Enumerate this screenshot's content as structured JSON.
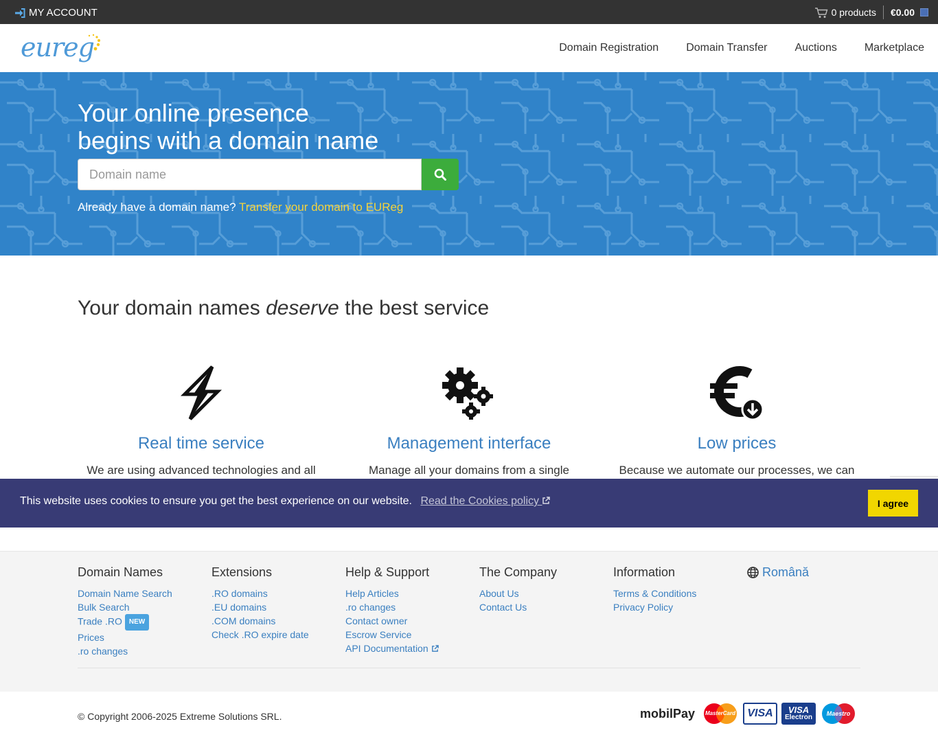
{
  "topbar": {
    "account_label": "MY ACCOUNT",
    "cart_products": "0 products",
    "cart_total": "€0.00"
  },
  "header": {
    "logo_text": "eureg",
    "nav": [
      "Domain Registration",
      "Domain Transfer",
      "Auctions",
      "Marketplace"
    ]
  },
  "hero": {
    "title_line1": "Your online presence",
    "title_line2": "begins with a domain name",
    "search_placeholder": "Domain name",
    "transfer_prefix": "Already have a domain name?",
    "transfer_link": "Transfer your domain to EUReg"
  },
  "service": {
    "title_before": "Your domain names ",
    "title_emphasis": "deserve",
    "title_after": " the best service",
    "features": [
      {
        "icon": "lightning-icon",
        "title": "Real time service",
        "text": "We are using advanced technologies and all"
      },
      {
        "icon": "gears-icon",
        "title": "Management interface",
        "text": "Manage all your domains from a single interface"
      },
      {
        "icon": "euro-down-icon",
        "title": "Low prices",
        "text": "Because we automate our processes, we can"
      }
    ]
  },
  "cookie": {
    "message": "This website uses cookies to ensure you get the best experience on our website.",
    "link": "Read the Cookies policy",
    "button": "I agree"
  },
  "footer": {
    "columns": [
      {
        "title": "Domain Names",
        "items": [
          "Domain Name Search",
          "Bulk Search",
          "Trade .RO",
          "Prices",
          ".ro changes"
        ]
      },
      {
        "title": "Extensions",
        "items": [
          ".RO domains",
          ".EU domains",
          ".COM domains",
          "Check .RO expire date"
        ]
      },
      {
        "title": "Help & Support",
        "items": [
          "Help Articles",
          ".ro changes",
          "Contact owner",
          "Escrow Service",
          "API Documentation"
        ]
      },
      {
        "title": "The Company",
        "items": [
          "About Us",
          "Contact Us"
        ]
      },
      {
        "title": "Information",
        "items": [
          "Terms & Conditions",
          "Privacy Policy"
        ]
      }
    ],
    "new_badge": "NEW",
    "language": "Română",
    "copyright": "© Copyright 2006-2025 Extreme Solutions SRL.",
    "payments": {
      "mobilpay": "mobilPay",
      "mastercard": "MasterCard",
      "visa": "VISA",
      "electron_top": "VISA",
      "electron_bottom": "Electron",
      "maestro": "Maestro"
    }
  },
  "colors": {
    "hero_blue": "#3083c9",
    "search_green": "#3cac3c",
    "link_yellow": "#f5d33c",
    "cookie_bg": "#383b75",
    "agree_yellow": "#f1d600",
    "heading_blue": "#3a7fc0"
  }
}
